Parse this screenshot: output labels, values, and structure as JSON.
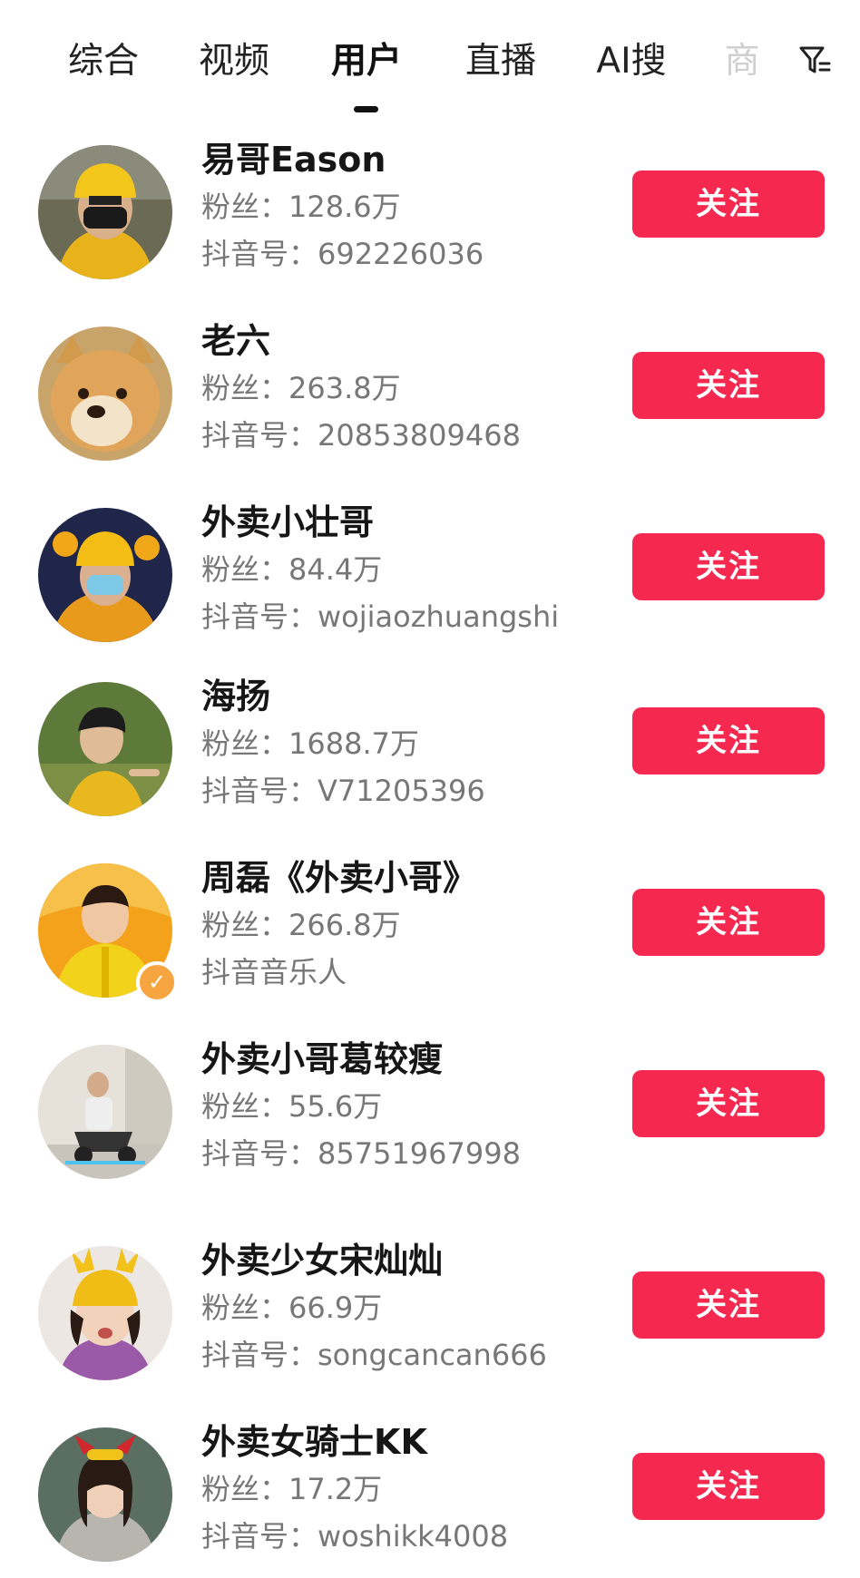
{
  "tabs": [
    {
      "label": "综合"
    },
    {
      "label": "视频"
    },
    {
      "label": "用户",
      "active": true
    },
    {
      "label": "直播"
    },
    {
      "label": "AI搜"
    },
    {
      "label": "商"
    }
  ],
  "colors": {
    "accent": "#f5294f",
    "verified": "#f7a540",
    "text_primary": "#161616",
    "text_secondary": "#777777"
  },
  "users": [
    {
      "name": "易哥Eason",
      "fans": "粉丝：128.6万",
      "uid": "抖音号：692226036",
      "button": "关注",
      "avatar_icon": "avatar-rider-yellow-helmet"
    },
    {
      "name": "老六",
      "fans": "粉丝：263.8万",
      "uid": "抖音号：20853809468",
      "button": "关注",
      "avatar_icon": "avatar-shiba-dog"
    },
    {
      "name": "外卖小壮哥",
      "fans": "粉丝：84.4万",
      "uid": "抖音号：wojiaozhuangshi",
      "button": "关注",
      "avatar_icon": "avatar-rider-mask"
    },
    {
      "name": "海扬",
      "fans": "粉丝：1688.7万",
      "uid": "抖音号：V71205396",
      "button": "关注",
      "avatar_icon": "avatar-outdoor-yellow"
    },
    {
      "name": "周磊《外卖小哥》",
      "fans": "粉丝：266.8万",
      "uid": "抖音音乐人",
      "button": "关注",
      "avatar_icon": "avatar-orange-jacket",
      "verified": true
    },
    {
      "name": "外卖小哥葛较瘦",
      "fans": "粉丝：55.6万",
      "uid": "抖音号：85751967998",
      "button": "关注",
      "avatar_icon": "avatar-scooter"
    },
    {
      "name": "外卖少女宋灿灿",
      "fans": "粉丝：66.9万",
      "uid": "抖音号：songcancan666",
      "button": "关注",
      "avatar_icon": "avatar-girl-antler-helmet"
    },
    {
      "name": "外卖女骑士KK",
      "fans": "粉丝：17.2万",
      "uid": "抖音号：woshikk4008",
      "button": "关注",
      "avatar_icon": "avatar-girl-red-bow"
    }
  ]
}
